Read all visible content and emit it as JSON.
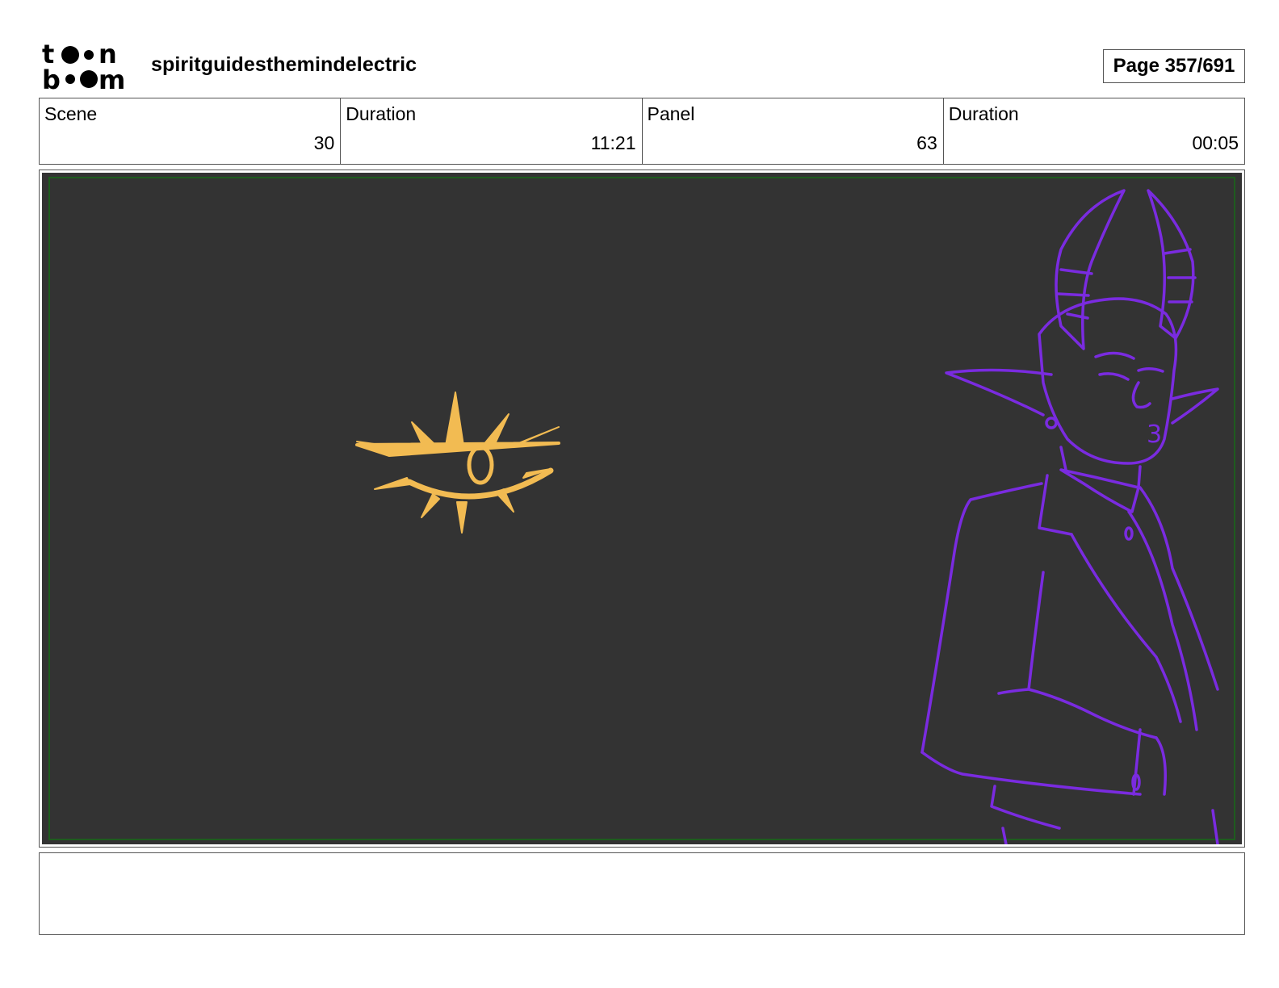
{
  "header": {
    "logo_text": "toon boom",
    "project_title": "spiritguidesthemindelectric",
    "page_number": "Page 357/691"
  },
  "info": {
    "scene_label": "Scene",
    "scene_value": "30",
    "scene_duration_label": "Duration",
    "scene_duration_value": "11:21",
    "panel_label": "Panel",
    "panel_value": "63",
    "panel_duration_label": "Duration",
    "panel_duration_value": "00:05"
  },
  "panel": {
    "background_color": "#333333",
    "safe_frame_color": "#1e5c1e",
    "eye_symbol_color": "#f2bb52",
    "character_line_color": "#7a2be0"
  },
  "notes": {
    "text": ""
  }
}
